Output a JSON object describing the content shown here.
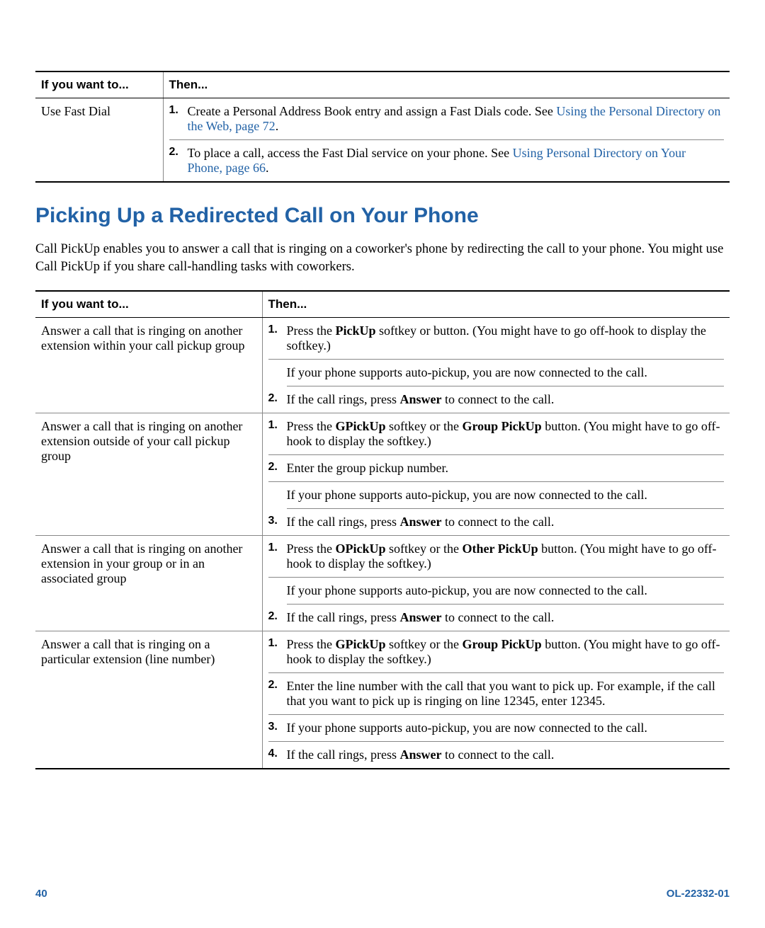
{
  "table1": {
    "headers": {
      "col1": "If you want to...",
      "col2": "Then..."
    },
    "rows": [
      {
        "want": "Use Fast Dial",
        "steps": [
          {
            "num": "1.",
            "text_pre": "Create a Personal Address Book entry and assign a Fast Dials code. See ",
            "link": "Using the Personal Directory on the Web, page 72",
            "text_post": "."
          },
          {
            "num": "2.",
            "text_pre": "To place a call, access the Fast Dial service on your phone. See ",
            "link": "Using Personal Directory on Your Phone, page 66",
            "text_post": "."
          }
        ]
      }
    ]
  },
  "heading": "Picking Up a Redirected Call on Your Phone",
  "intro": "Call PickUp enables you to answer a call that is ringing on a coworker's phone by redirecting the call to your phone. You might use Call PickUp if you share call-handling tasks with coworkers.",
  "table2": {
    "headers": {
      "col1": "If you want to...",
      "col2": "Then..."
    },
    "rows": [
      {
        "want": "Answer a call that is ringing on another extension within your call pickup group",
        "items": [
          {
            "type": "step",
            "num": "1.",
            "parts": [
              {
                "t": "plain",
                "v": "Press the "
              },
              {
                "t": "bold",
                "v": "PickUp"
              },
              {
                "t": "plain",
                "v": " softkey or button. (You might have to go off-hook to display the softkey.)"
              }
            ],
            "border": true
          },
          {
            "type": "sub",
            "parts": [
              {
                "t": "plain",
                "v": "If your phone supports auto-pickup, you are now connected to the call."
              }
            ],
            "border": true
          },
          {
            "type": "step",
            "num": "2.",
            "parts": [
              {
                "t": "plain",
                "v": "If the call rings, press "
              },
              {
                "t": "bold",
                "v": "Answer"
              },
              {
                "t": "plain",
                "v": " to connect to the call."
              }
            ],
            "border": false
          }
        ]
      },
      {
        "want": "Answer a call that is ringing on another extension outside of your call pickup group",
        "items": [
          {
            "type": "step",
            "num": "1.",
            "parts": [
              {
                "t": "plain",
                "v": "Press the "
              },
              {
                "t": "bold",
                "v": "GPickUp"
              },
              {
                "t": "plain",
                "v": " softkey or the "
              },
              {
                "t": "bold",
                "v": "Group PickUp"
              },
              {
                "t": "plain",
                "v": " button. (You might have to go off-hook to display the softkey.)"
              }
            ],
            "border": true
          },
          {
            "type": "step",
            "num": "2.",
            "parts": [
              {
                "t": "plain",
                "v": "Enter the group pickup number."
              }
            ],
            "border": true
          },
          {
            "type": "sub",
            "parts": [
              {
                "t": "plain",
                "v": "If your phone supports auto-pickup, you are now connected to the call."
              }
            ],
            "border": true
          },
          {
            "type": "step",
            "num": "3.",
            "parts": [
              {
                "t": "plain",
                "v": "If the call rings, press "
              },
              {
                "t": "bold",
                "v": "Answer"
              },
              {
                "t": "plain",
                "v": " to connect to the call."
              }
            ],
            "border": false
          }
        ]
      },
      {
        "want": "Answer a call that is ringing on another extension in your group or in an associated group",
        "items": [
          {
            "type": "step",
            "num": "1.",
            "parts": [
              {
                "t": "plain",
                "v": "Press the "
              },
              {
                "t": "bold",
                "v": "OPickUp"
              },
              {
                "t": "plain",
                "v": " softkey or the "
              },
              {
                "t": "bold",
                "v": "Other PickUp"
              },
              {
                "t": "plain",
                "v": " button. (You might have to go off-hook to display the softkey.)"
              }
            ],
            "border": true
          },
          {
            "type": "sub",
            "parts": [
              {
                "t": "plain",
                "v": "If your phone supports auto-pickup, you are now connected to the call."
              }
            ],
            "border": true
          },
          {
            "type": "step",
            "num": "2.",
            "parts": [
              {
                "t": "plain",
                "v": "If the call rings, press "
              },
              {
                "t": "bold",
                "v": "Answer"
              },
              {
                "t": "plain",
                "v": " to connect to the call."
              }
            ],
            "border": false
          }
        ]
      },
      {
        "want": "Answer a call that is ringing on a particular extension (line number)",
        "items": [
          {
            "type": "step",
            "num": "1.",
            "parts": [
              {
                "t": "plain",
                "v": "Press the "
              },
              {
                "t": "bold",
                "v": "GPickUp"
              },
              {
                "t": "plain",
                "v": " softkey or the "
              },
              {
                "t": "bold",
                "v": "Group PickUp"
              },
              {
                "t": "plain",
                "v": " button. (You might have to go off-hook to display the softkey.)"
              }
            ],
            "border": true
          },
          {
            "type": "step",
            "num": "2.",
            "parts": [
              {
                "t": "plain",
                "v": "Enter the line number with the call that you want to pick up. For example, if the call that you want to pick up is ringing on line 12345, enter 12345."
              }
            ],
            "border": true
          },
          {
            "type": "step",
            "num": "3.",
            "parts": [
              {
                "t": "plain",
                "v": "If your phone supports auto-pickup, you are now connected to the call."
              }
            ],
            "border": true
          },
          {
            "type": "step",
            "num": "4.",
            "parts": [
              {
                "t": "plain",
                "v": "If the call rings, press "
              },
              {
                "t": "bold",
                "v": "Answer"
              },
              {
                "t": "plain",
                "v": " to connect to the call."
              }
            ],
            "border": false
          }
        ]
      }
    ]
  },
  "footer": {
    "page": "40",
    "docid": "OL-22332-01"
  }
}
